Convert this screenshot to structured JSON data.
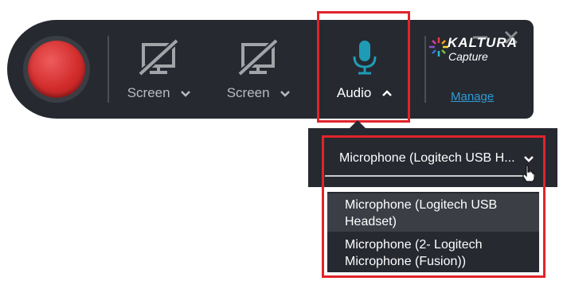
{
  "toolbar": {
    "record_button": "record",
    "sources": [
      {
        "label": "Screen",
        "icon": "screen-off-icon",
        "state": "disabled"
      },
      {
        "label": "Screen",
        "icon": "screen-off-icon",
        "state": "disabled"
      },
      {
        "label": "Audio",
        "icon": "microphone-icon",
        "state": "active"
      }
    ],
    "window_controls": [
      "minimize-icon",
      "close-icon"
    ]
  },
  "brand": {
    "name": "KALTURA",
    "product": "Capture",
    "manage_link": "Manage"
  },
  "audio_dropdown": {
    "selected_value": "Microphone (Logitech USB H...",
    "options": [
      "Microphone (Logitech USB Headset)",
      "Microphone (2- Logitech Microphone (Fusion))"
    ]
  },
  "colors": {
    "toolbar_bg": "#262930",
    "record_red": "#d22c2c",
    "mic_teal": "#1f9bb5",
    "link_blue": "#2f9bd6",
    "highlight_red": "#e0242b"
  }
}
